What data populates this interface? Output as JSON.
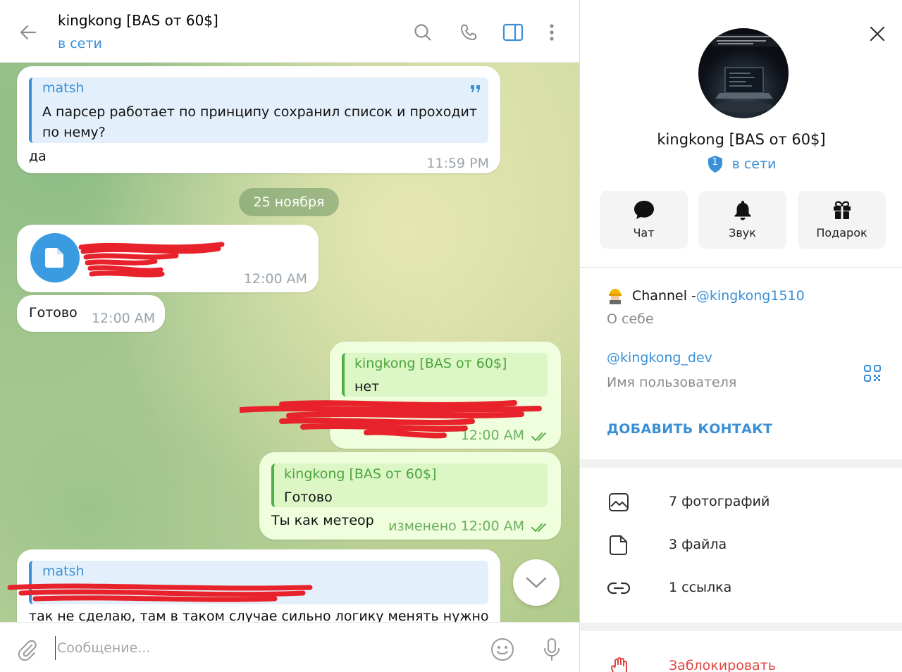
{
  "header": {
    "title": "kingkong [BAS от 60$]",
    "status": "в сети"
  },
  "messages": {
    "msg1": {
      "quote_author": "matsh",
      "quote_text": "А парсер работает по принципу сохранил список и проходит по нему?",
      "text": "да",
      "time": "11:59 PM"
    },
    "date_separator": "25 ноября",
    "msg2": {
      "time": "12:00 AM"
    },
    "msg3": {
      "text": "Готово",
      "time": "12:00 AM"
    },
    "msg4": {
      "quote_author": "kingkong [BAS от 60$]",
      "quote_text": "нет",
      "time": "12:00 AM"
    },
    "msg5": {
      "quote_author": "kingkong [BAS от 60$]",
      "quote_text": "Готово",
      "text": "Ты как метеор",
      "time": "изменено 12:00 AM"
    },
    "msg6": {
      "quote_author": "matsh",
      "text": "так не сделаю, там в таком случае сильно логику менять нужно"
    }
  },
  "composer": {
    "placeholder": "Сообщение..."
  },
  "profile": {
    "name": "kingkong [BAS от 60$]",
    "badge_count": "1",
    "status": "в сети",
    "actions": [
      {
        "label": "Чат",
        "icon": "chat-icon"
      },
      {
        "label": "Звук",
        "icon": "bell-icon"
      },
      {
        "label": "Подарок",
        "icon": "gift-icon"
      }
    ],
    "bio_prefix": "Channel - ",
    "bio_link": "@kingkong1510",
    "bio_label": "О себе",
    "username": "@kingkong_dev",
    "username_label": "Имя пользователя",
    "add_contact": "ДОБАВИТЬ КОНТАКТ",
    "media": [
      {
        "label": "7 фотографий",
        "icon": "photo-icon"
      },
      {
        "label": "3 файла",
        "icon": "file-icon"
      },
      {
        "label": "1 ссылка",
        "icon": "link-icon"
      }
    ],
    "block": "Заблокировать"
  },
  "colors": {
    "accent": "#3a8fd6",
    "outgoing_bubble": "#effedd",
    "outgoing_accent": "#4aa53b",
    "danger": "#e0453f"
  }
}
